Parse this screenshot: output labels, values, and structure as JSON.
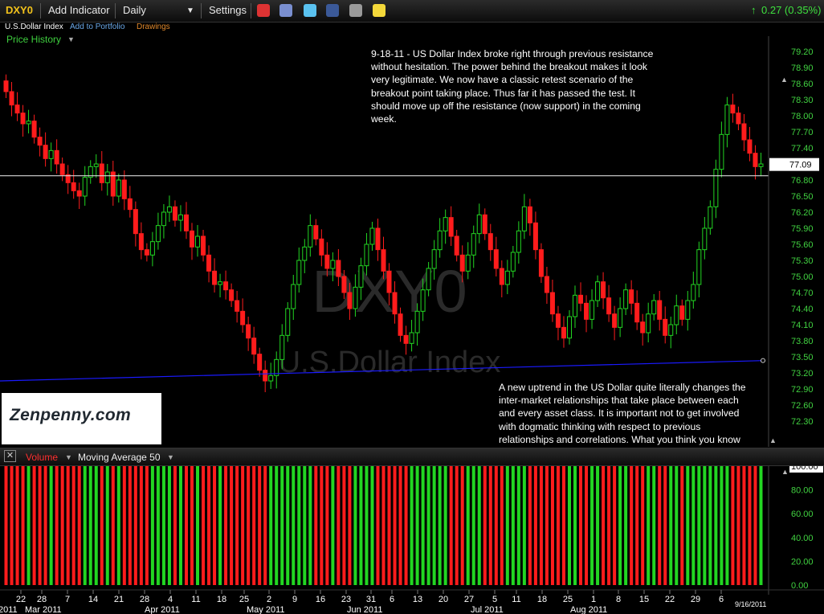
{
  "toolbar": {
    "symbol": "DXY0",
    "add_indicator": "Add Indicator",
    "interval": "Daily",
    "settings": "Settings",
    "change": "0.27 (0.35%)",
    "icons": [
      "alarm-clock-icon",
      "stack-icon",
      "twitter-icon",
      "facebook-icon",
      "binoculars-icon",
      "note-icon"
    ]
  },
  "links": {
    "name": "U.S.Dollar Index",
    "portfolio": "Add to Portfolio",
    "drawings": "Drawings"
  },
  "price_history_label": "Price History",
  "notes": {
    "top": [
      "9-18-11 - US Dollar Index broke right through previous resistance",
      "without hesitation. The power behind the breakout makes it look",
      "very legitimate. We now have a classic retest scenario of the",
      "breakout point taking place. Thus far it has passed the test. It",
      "should move up off the resistance (now support) in the coming",
      "week."
    ],
    "bottom": [
      "A new uptrend in the US Dollar quite literally changes the",
      "inter-market relationships that take place between each",
      "and every asset class. It is important not to get involved",
      "with dogmatic thinking with respect to previous",
      "relationships and correlations. What you think you know",
      "may end up hurting you."
    ]
  },
  "watermark": {
    "symbol": "DXY0",
    "name": "U.S.Dollar Index"
  },
  "logo_text": "Zenpenny.com",
  "volume_bar": {
    "volume": "Volume",
    "ma": "Moving Average 50"
  },
  "colors": {
    "up": "#22d622",
    "down": "#ff1c1c",
    "support": "#d8d8d8",
    "trend": "#1a1aff",
    "axis": "#41d241"
  },
  "chart_data": [
    {
      "type": "candlestick",
      "title": "U.S.Dollar Index",
      "ylim": [
        72.0,
        79.5
      ],
      "y_ticks": [
        79.2,
        78.9,
        78.6,
        78.3,
        78.0,
        77.7,
        77.4,
        77.09,
        76.8,
        76.5,
        76.2,
        75.9,
        75.6,
        75.3,
        75.0,
        74.7,
        74.4,
        74.1,
        73.8,
        73.5,
        73.2,
        72.9,
        72.6,
        72.3
      ],
      "current_price": "77.09",
      "x_ticks": [
        "22",
        "28",
        "7",
        "14",
        "21",
        "28",
        "4",
        "11",
        "18",
        "25",
        "2",
        "9",
        "16",
        "23",
        "31",
        "6",
        "13",
        "20",
        "27",
        "5",
        "11",
        "18",
        "25",
        "1",
        "8",
        "15",
        "22",
        "29",
        "6"
      ],
      "month_labels": [
        "2011",
        "Mar 2011",
        "Apr 2011",
        "May 2011",
        "Jun 2011",
        "Jul 2011",
        "Aug 2011"
      ],
      "date_label": "9/16/2011",
      "support_level": 76.88,
      "trendline": {
        "from": [
          0,
          73.05
        ],
        "to": [
          1,
          73.43
        ]
      },
      "close": [
        78.45,
        78.2,
        78.05,
        77.85,
        77.9,
        77.6,
        77.45,
        77.2,
        77.35,
        77.1,
        76.9,
        76.75,
        76.6,
        76.5,
        76.85,
        77.05,
        77.1,
        76.75,
        76.95,
        76.5,
        76.8,
        76.45,
        76.25,
        75.8,
        75.5,
        75.4,
        75.65,
        75.95,
        76.2,
        76.3,
        76.05,
        76.15,
        75.85,
        75.55,
        75.75,
        75.4,
        75.1,
        74.85,
        74.9,
        74.75,
        74.55,
        74.35,
        74.1,
        73.85,
        73.55,
        73.25,
        73.05,
        73.15,
        73.45,
        73.9,
        74.4,
        74.85,
        75.3,
        75.55,
        75.95,
        75.7,
        75.4,
        75.15,
        75.3,
        75.0,
        74.7,
        74.4,
        74.8,
        75.2,
        75.6,
        75.9,
        75.5,
        75.1,
        74.7,
        74.3,
        73.9,
        73.75,
        73.95,
        74.35,
        74.75,
        75.15,
        75.5,
        75.85,
        76.1,
        75.75,
        75.4,
        75.1,
        75.4,
        75.8,
        76.15,
        75.8,
        75.5,
        75.15,
        74.85,
        75.1,
        75.45,
        75.85,
        76.3,
        76.0,
        75.5,
        75.0,
        74.7,
        74.3,
        74.05,
        73.85,
        74.25,
        74.65,
        74.5,
        74.2,
        74.55,
        74.9,
        74.6,
        74.3,
        74.05,
        74.4,
        74.75,
        74.5,
        74.15,
        73.95,
        74.3,
        74.55,
        74.2,
        73.9,
        74.1,
        74.45,
        74.2,
        74.55,
        74.85,
        75.5,
        75.9,
        76.3,
        77.0,
        77.65,
        78.2,
        78.05,
        77.85,
        77.55,
        77.3,
        77.05,
        77.1
      ]
    },
    {
      "type": "bar",
      "title": "Volume",
      "y_ticks": [
        100.0,
        80.0,
        60.0,
        40.0,
        20.0,
        0.0
      ],
      "ylim": [
        0,
        100
      ],
      "values": "all 100 (full-height bars colored by daily direction)"
    }
  ]
}
